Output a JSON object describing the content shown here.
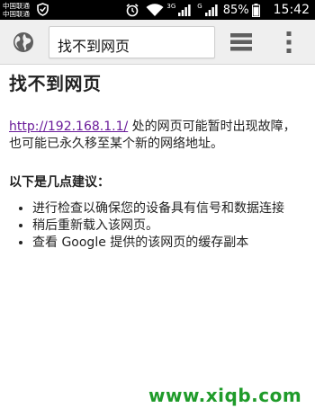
{
  "status_bar": {
    "carrier_1": "中国联通",
    "carrier_2": "中国联通",
    "sim_1_label": "3G",
    "sim_2_label": "G",
    "battery": "85%",
    "time": "15:42"
  },
  "toolbar": {
    "title": "找不到网页"
  },
  "page": {
    "heading": "找不到网页",
    "url_link": "http://192.168.1.1/",
    "message": " 处的网页可能暂时出现故障，也可能已永久移至某个新的网络地址。",
    "suggestions_heading": "以下是几点建议：",
    "suggestions": [
      "进行检查以确保您的设备具有信号和数据连接",
      "稍后重新载入该网页。",
      "查看 Google 提供的该网页的缓存副本"
    ]
  },
  "watermark": "www.xiqb.com",
  "colors": {
    "link": "#6a1b9a",
    "watermark": "#1f9b2a",
    "status_bar_bg": "#000000",
    "toolbar_bg": "#efefef"
  }
}
